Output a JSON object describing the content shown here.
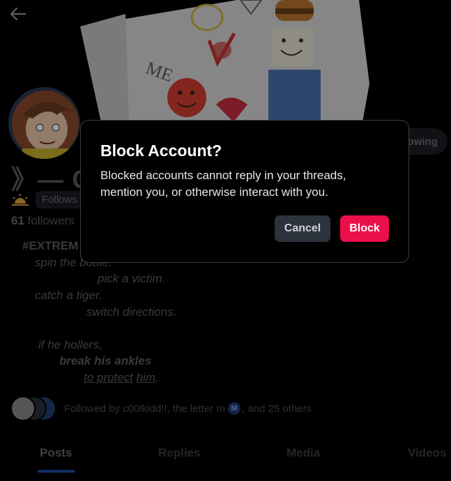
{
  "header": {
    "back_icon": "arrow-left-icon"
  },
  "profile": {
    "display_name": "》— C",
    "following_label": "owing",
    "follows_badge": "Follows",
    "followers_count": "61",
    "followers_label": "followers",
    "bio": {
      "hashtag": "#EXTREM",
      "line1": "spin the bottle.",
      "line2": "pick a victim.",
      "line3": "catch a tiger.",
      "line4": "switch directions.",
      "line5": "if he hollers,",
      "line6": "break his ankles",
      "line7_pre": "to protect",
      "line7_mid": " ",
      "line7_ul": "him",
      "line7_post": "."
    }
  },
  "followed_by": {
    "prefix": "Followed by c00lkidd!!, the letter m",
    "badge": "M",
    "suffix": ", and 25 others"
  },
  "tabs": [
    {
      "label": "Posts"
    },
    {
      "label": "Replies"
    },
    {
      "label": "Media"
    },
    {
      "label": "Videos"
    }
  ],
  "modal": {
    "title": "Block Account?",
    "body": "Blocked accounts cannot reply in your threads, mention you, or otherwise interact with you.",
    "cancel_label": "Cancel",
    "block_label": "Block"
  },
  "colors": {
    "block_button": "#ec0f4c",
    "tab_underline": "#1d4ea8"
  }
}
